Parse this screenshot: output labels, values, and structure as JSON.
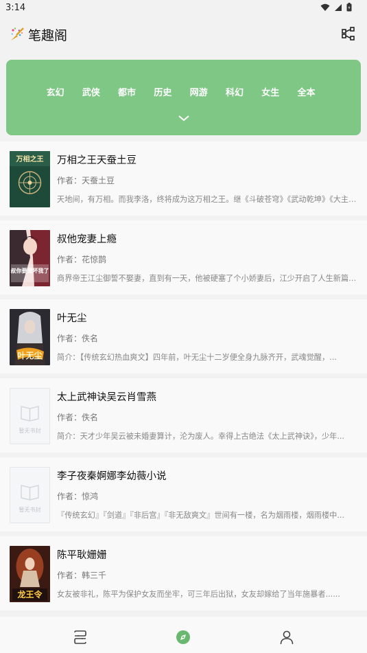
{
  "status": {
    "time": "3:14"
  },
  "app": {
    "title": "笔趣阁"
  },
  "categories": [
    "玄幻",
    "武侠",
    "都市",
    "历史",
    "网游",
    "科幻",
    "女生",
    "全本"
  ],
  "books": [
    {
      "title": "万相之王天蚕土豆",
      "author": "作者：天蚕土豆",
      "desc": "天地间，有万相。而我李洛，终将成为这万相之王。继《斗破苍穹》《武动乾坤》《大主宰》《元尊》之后，天蚕土豆又一部...",
      "cover_text": "万相之王"
    },
    {
      "title": "叔他宠妻上瘾",
      "author": "作者：花惊鹊",
      "desc": "商界帝王江尘御誓不娶妻，直到有一天，他被硬塞了个小娇妻后，江少开启了人生新篇章...",
      "cover_text": "叔你要宠坏我了"
    },
    {
      "title": "叶无尘",
      "author": "作者：佚名",
      "desc": "简介：【传统玄幻热血爽文】四年前，叶无尘十二岁便全身九脉齐开，武魂觉醒，...",
      "cover_text": "叶无尘"
    },
    {
      "title": "太上武神诀吴云肖雪燕",
      "author": "作者：佚名",
      "desc": "简介：天才少年吴云被未婚妻算计，沦为废人。幸得上古绝法《太上武神诀》，少年...",
      "cover_text": "暂无书封"
    },
    {
      "title": "李子夜秦婀娜李幼薇小说",
      "author": "作者：惊鸿",
      "desc": "『传统玄幻』『剑道』『非后宫』『非无敌爽文』世间有一楼，名为烟雨楼，烟雨楼中...",
      "cover_text": "暂无书封"
    },
    {
      "title": "陈平耿姗姗",
      "author": "作者：韩三千",
      "desc": "女友被非礼，陈平为保护女友而坐牢，可三年后出狱，女友却嫁给了当年施暴者......",
      "cover_text": "龙王令"
    }
  ],
  "colors": {
    "accent": "#7fc785",
    "nav_active": "#6ab86f"
  }
}
